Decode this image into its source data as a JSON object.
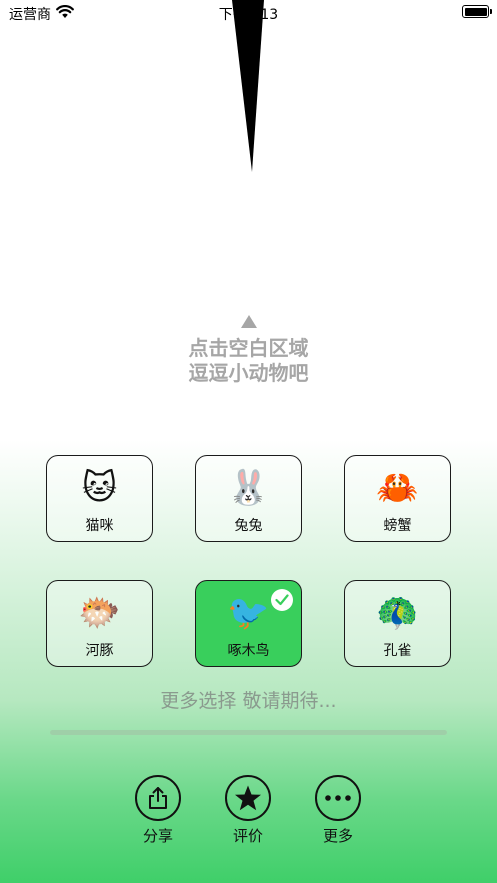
{
  "status_bar": {
    "carrier": "运营商",
    "time": "下午4:13",
    "battery_level": 1.0
  },
  "hint": {
    "line1": "点击空白区域",
    "line2": "逗逗小动物吧"
  },
  "animals": [
    {
      "emoji": "🐱",
      "label": "猫咪",
      "selected": false
    },
    {
      "emoji": "🐰",
      "label": "兔兔",
      "selected": false
    },
    {
      "emoji": "🦀",
      "label": "螃蟹",
      "selected": false
    },
    {
      "emoji": "🐡",
      "label": "河豚",
      "selected": false
    },
    {
      "emoji": "🐦",
      "label": "啄木鸟",
      "selected": true
    },
    {
      "emoji": "🦚",
      "label": "孔雀",
      "selected": false
    }
  ],
  "more_text": "更多选择 敬请期待...",
  "actions": [
    {
      "icon": "share-icon",
      "label": "分享"
    },
    {
      "icon": "star-icon",
      "label": "评价"
    },
    {
      "icon": "more-icon",
      "label": "更多"
    }
  ],
  "colors": {
    "selected": "#39cf5c",
    "hint": "#a6a6a6",
    "accent_bottom": "#3fcf69"
  }
}
